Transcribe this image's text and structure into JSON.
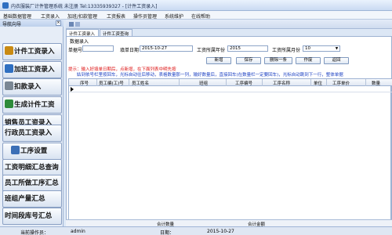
{
  "window": {
    "title": "内衣服装厂计件管理系统 未注册  Tel:13335939327 - [计件工资录入]"
  },
  "menu": [
    "基础数据管理",
    "工资录入",
    "加班/扣款管理",
    "工资报表",
    "操作员管理",
    "系统维护",
    "在线帮助"
  ],
  "sidebar": {
    "header": "导航向导",
    "pin": "×",
    "items": [
      {
        "label": "计件工资录入",
        "icon": "wallet-icon",
        "icon_color": "#c98a12"
      },
      {
        "label": "加班工资录入",
        "icon": "clock-icon",
        "icon_color": "#2f6fc1"
      },
      {
        "label": "扣款录入",
        "icon": "deduct-icon",
        "icon_color": "#7b8794"
      },
      {
        "label": "生成计件工资",
        "icon": "gear-icon",
        "icon_color": "#2e8b3a"
      },
      {
        "label": "销售员工资录入",
        "icon": "",
        "icon_color": ""
      },
      {
        "label": "行政员工资录入",
        "icon": "",
        "icon_color": ""
      },
      {
        "label": "工序设置",
        "icon": "settings-icon",
        "icon_color": "#3b6fb6"
      },
      {
        "label": "工资明细汇总查询",
        "icon": "",
        "icon_color": ""
      },
      {
        "label": "员工所做工序汇总",
        "icon": "",
        "icon_color": ""
      },
      {
        "label": "班组产量汇总",
        "icon": "",
        "icon_color": ""
      },
      {
        "label": "时间段库号汇总",
        "icon": "",
        "icon_color": ""
      }
    ]
  },
  "tabs": [
    {
      "label": "计件工资录入",
      "active": true
    },
    {
      "label": "计件工资查询",
      "active": false
    }
  ],
  "form": {
    "section": "数据录入",
    "bill_no_label": "单据号",
    "bill_no": "",
    "date_label": "填单日期",
    "date": "2015-10-27",
    "year_label": "工资所属年份",
    "year": "2015",
    "month_label": "工资所属月份",
    "month": "10"
  },
  "buttons": [
    "新增",
    "保存",
    "删除一条",
    "作废",
    "返回"
  ],
  "tips": {
    "line1": "提示：输入好填单日期后，点新增，在下面列表中明先按",
    "line2": "姑到依号栏里按回车，光标自动往后移动，表格数量那一列，输好数量后，直接回车(在数量栏一定要回车)，光标自动跳到下一行，整体单据"
  },
  "table": {
    "columns": [
      "序号",
      "员工编(工)号",
      "员工姓名",
      "班组",
      "工序编号",
      "工序名称",
      "单位",
      "工序单价",
      "数量"
    ]
  },
  "summary": {
    "qty_label": "合计数量",
    "amount_label": "合计金额"
  },
  "status": {
    "operator_label": "当前操作员：",
    "operator": "admin",
    "date_label": "日期：",
    "date": "2015-10-27"
  }
}
